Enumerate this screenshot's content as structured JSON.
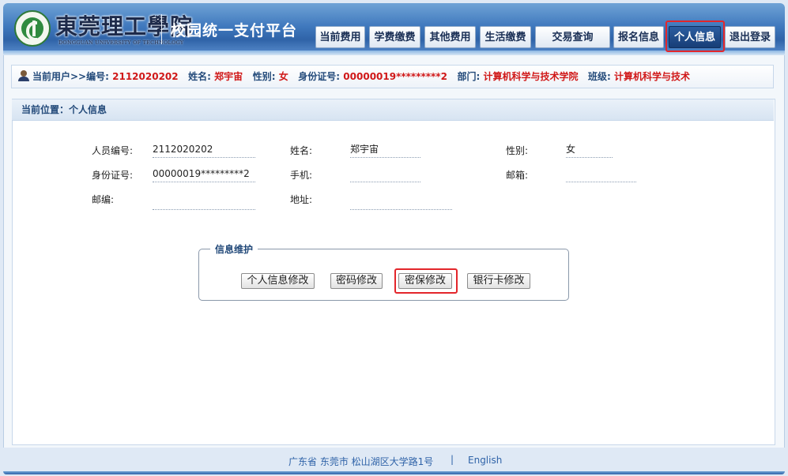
{
  "header": {
    "school_name": "東莞理工學院",
    "school_name_en": "DONGGUAN UNIVERSITY OF TECHNOLOGY",
    "platform_title": "校园统一支付平台",
    "nav": [
      {
        "label": "当前费用"
      },
      {
        "label": "学费缴费"
      },
      {
        "label": "其他费用"
      },
      {
        "label": "生活缴费"
      },
      {
        "label": "交易查询"
      },
      {
        "label": "报名信息"
      },
      {
        "label": "个人信息",
        "active": true
      },
      {
        "label": "退出登录"
      }
    ]
  },
  "userbar": {
    "prefix": "当前用户>>",
    "id_label": "编号:",
    "id_value": "2112020202",
    "name_label": "姓名:",
    "name_value": "郑宇宙",
    "gender_label": "性别:",
    "gender_value": "女",
    "idcard_label": "身份证号:",
    "idcard_value": "00000019*********2",
    "dept_label": "部门:",
    "dept_value": "计算机科学与技术学院",
    "class_label": "班级:",
    "class_value": "计算机科学与技术"
  },
  "breadcrumb": "当前位置：个人信息",
  "profile": {
    "staff_no_label": "人员编号:",
    "staff_no": "2112020202",
    "name_label": "姓名:",
    "name": "郑宇宙",
    "gender_label": "性别:",
    "gender": "女",
    "idcard_label": "身份证号:",
    "idcard": "00000019*********2",
    "phone_label": "手机:",
    "phone": "",
    "native_label": "邮箱:",
    "native": "",
    "postcode_label": "邮编:",
    "postcode": "",
    "address_label": "地址:",
    "address": ""
  },
  "maintenance": {
    "legend": "信息维护",
    "buttons": [
      "个人信息修改",
      "密码修改",
      "密保修改",
      "银行卡修改"
    ]
  },
  "footer": {
    "address": "广东省 东莞市 松山湖区大学路1号",
    "separator": "|",
    "language": "English"
  }
}
